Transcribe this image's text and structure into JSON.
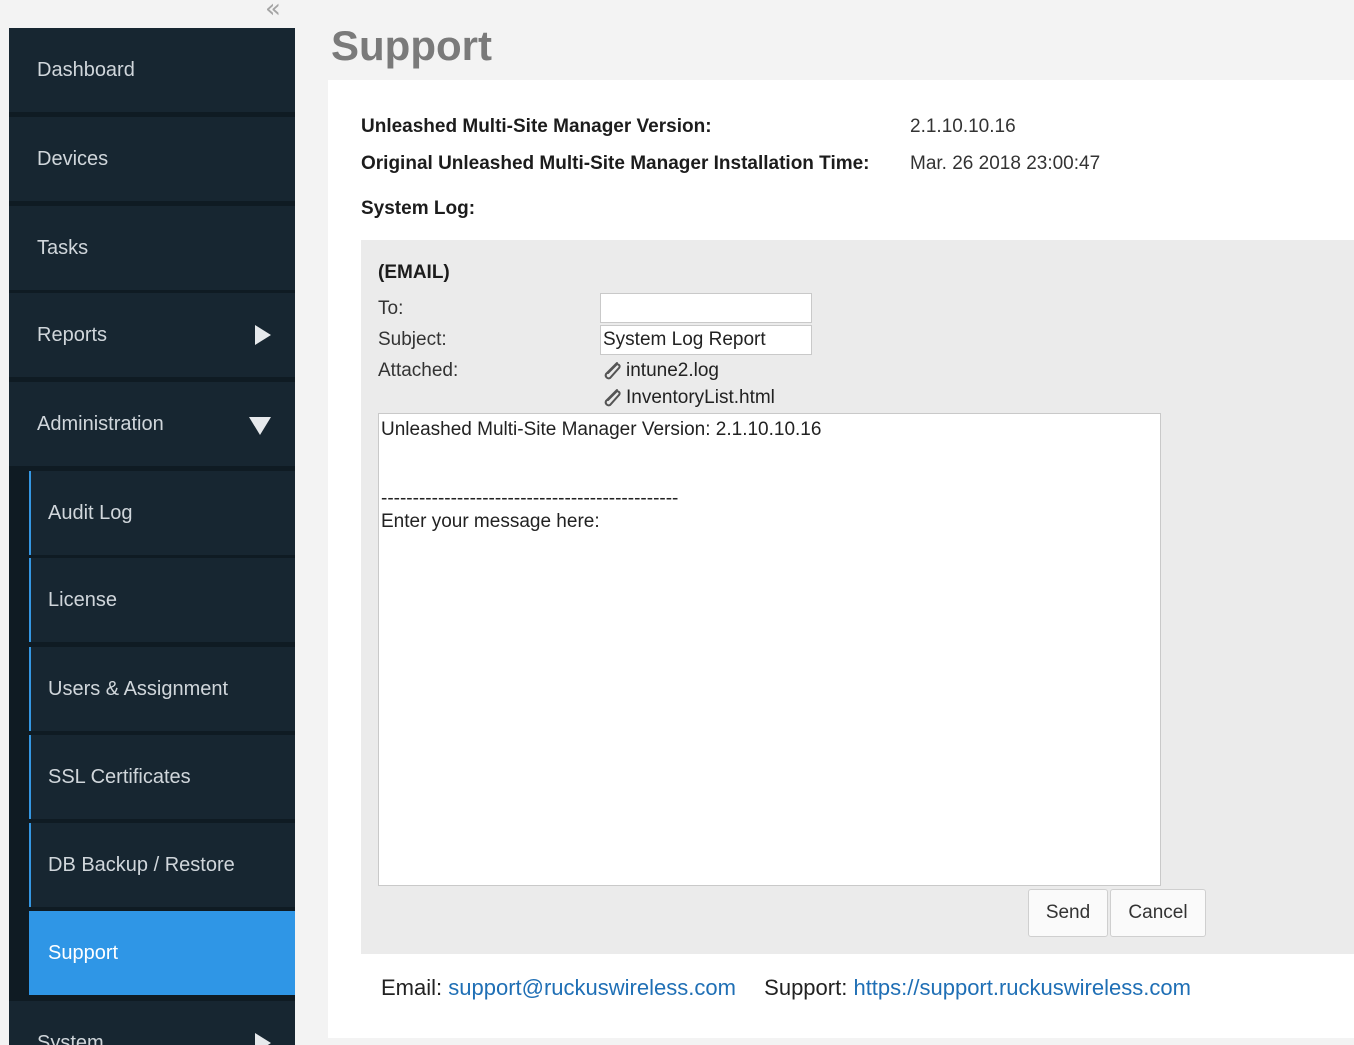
{
  "sidebar": {
    "items": [
      {
        "label": "Dashboard"
      },
      {
        "label": "Devices"
      },
      {
        "label": "Tasks"
      },
      {
        "label": "Reports",
        "icon": "chevron-right-icon"
      },
      {
        "label": "Administration",
        "icon": "chevron-down-icon",
        "expanded": true
      },
      {
        "label": "System",
        "icon": "chevron-right-icon"
      }
    ],
    "admin_subitems": [
      {
        "label": "Audit Log"
      },
      {
        "label": "License"
      },
      {
        "label": "Users & Assignment"
      },
      {
        "label": "SSL Certificates"
      },
      {
        "label": "DB Backup / Restore"
      },
      {
        "label": "Support",
        "active": true
      }
    ],
    "active_color": "#2f96e6",
    "background_color": "#172631"
  },
  "page": {
    "title": "Support",
    "version_label": "Unleashed Multi-Site Manager Version:",
    "version_value": "2.1.10.10.16",
    "install_label": "Original Unleashed Multi-Site Manager Installation Time:",
    "install_value": "Mar. 26 2018 23:00:47",
    "syslog_label": "System Log:"
  },
  "email": {
    "title": "(EMAIL)",
    "to_label": "To:",
    "to_value": "",
    "subject_label": "Subject:",
    "subject_value": "System Log Report",
    "attached_label": "Attached:",
    "attachments": [
      "intune2.log",
      "InventoryList.html"
    ],
    "message": "Unleashed Multi-Site Manager Version: 2.1.10.10.16\n\n\n-----------------------------------------------\nEnter your message here:",
    "send_label": "Send",
    "cancel_label": "Cancel"
  },
  "footer": {
    "email_label": "Email:",
    "email_link": "support@ruckuswireless.com",
    "support_label": "Support:",
    "support_link": "https://support.ruckuswireless.com"
  }
}
